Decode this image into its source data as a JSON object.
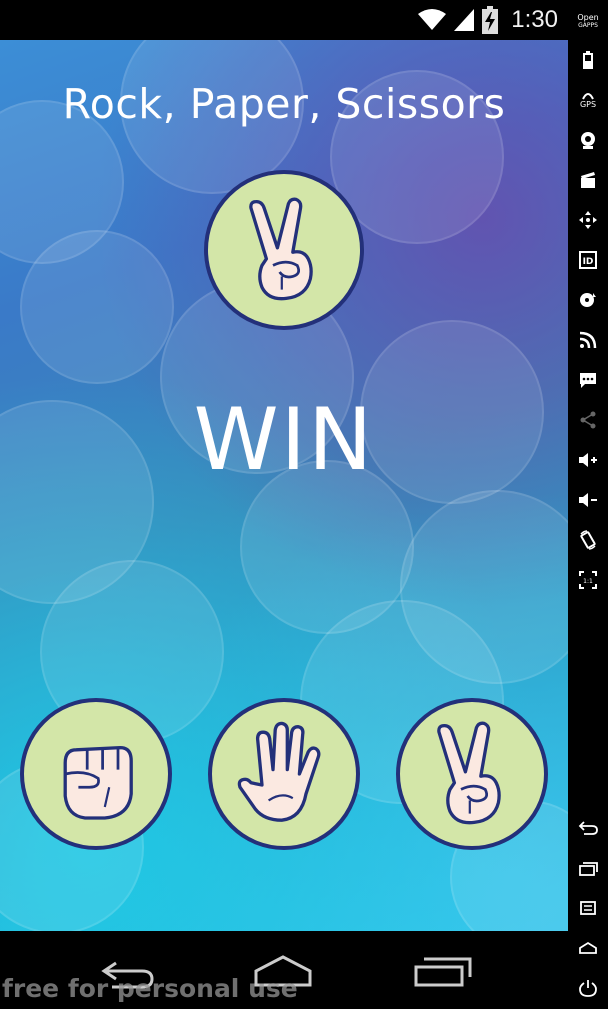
{
  "status_bar": {
    "time": "1:30",
    "icons": [
      "wifi-icon",
      "signal-icon",
      "battery-charging-icon"
    ]
  },
  "app": {
    "title": "Rock, Paper, Scissors",
    "result": "WIN",
    "computer_choice": "scissors",
    "choices": [
      {
        "name": "rock",
        "icon": "fist-icon"
      },
      {
        "name": "paper",
        "icon": "open-hand-icon"
      },
      {
        "name": "scissors",
        "icon": "peace-sign-icon"
      }
    ],
    "colors": {
      "hand_circle_fill": "#d3e6a8",
      "hand_circle_border": "#23307a",
      "text": "#ffffff"
    }
  },
  "side_toolbar": {
    "open_gapps_label_1": "Open",
    "open_gapps_label_2": "GAPPS",
    "gps_label": "GPS",
    "id_label": "ID",
    "pixel_ratio_label": "1:1",
    "items": [
      "open-gapps",
      "battery-icon",
      "gps-icon",
      "camera-icon",
      "clapperboard-icon",
      "move-icon",
      "id-icon",
      "disc-icon",
      "rss-icon",
      "sms-icon",
      "share-icon",
      "volume-up-icon",
      "volume-down-icon",
      "rotate-icon",
      "fullscreen-icon",
      "back-icon",
      "recents-icon",
      "menu-icon",
      "home-icon",
      "power-icon"
    ]
  },
  "nav_bar": {
    "buttons": [
      "back-button",
      "home-button",
      "recents-button"
    ]
  },
  "watermark": "free for personal use"
}
